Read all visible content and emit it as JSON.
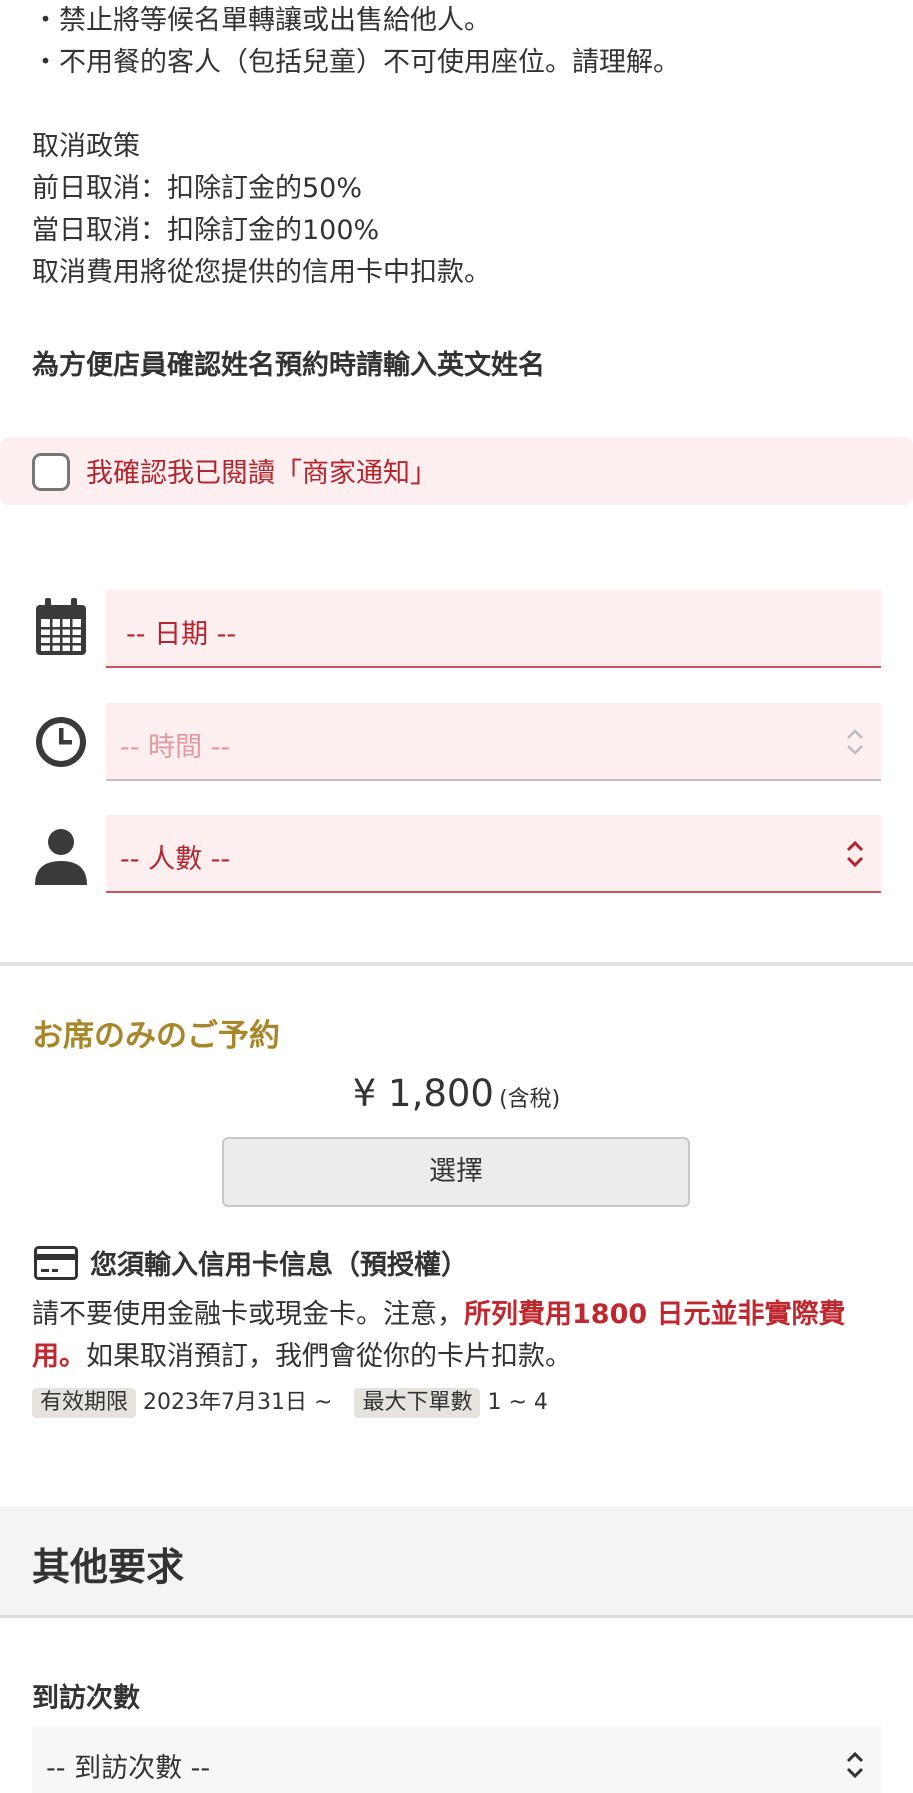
{
  "notice": {
    "lines": [
      "・禁止將等候名單轉讓或出售給他人。",
      "・不用餐的客人（包括兒童）不可使用座位。請理解。"
    ],
    "policy_title": "取消政策",
    "policy_lines": [
      "前日取消：扣除訂金的50%",
      "當日取消：扣除訂金的100%",
      "取消費用將從您提供的信用卡中扣款。"
    ],
    "english_name_note": "為方便店員確認姓名預約時請輸入英文姓名"
  },
  "confirm": {
    "label": "我確認我已閱讀「商家通知」",
    "checked": false
  },
  "form": {
    "date_placeholder": "-- 日期 --",
    "time_placeholder": "-- 時間 --",
    "party_placeholder": "-- 人數 --",
    "icons": {
      "date": "calendar-icon",
      "time": "clock-icon",
      "party": "person-icon"
    }
  },
  "plan": {
    "title": "お席のみのご予約",
    "price": "¥ 1,800",
    "tax_note": "(含稅)",
    "select_label": "選擇"
  },
  "card": {
    "title": "您須輸入信用卡信息（預授權）",
    "text_before": "請不要使用金融卡或現金卡。注意，",
    "text_warn": "所列費用1800 日元並非實際費用。",
    "text_after": "如果取消預訂，我們會從你的卡片扣款。",
    "validity_tag": "有效期限",
    "validity_value": "2023年7月31日 ~",
    "max_orders_tag": "最大下單數",
    "max_orders_value": "1 ~ 4"
  },
  "other": {
    "section_title": "其他要求",
    "visits_label": "到訪次數",
    "visits_placeholder": "-- 到訪次數 --"
  },
  "colors": {
    "accent_red": "#b3262f",
    "warn_red": "#c0282f",
    "gold": "#a8862a",
    "field_bg": "#fdeef0"
  }
}
